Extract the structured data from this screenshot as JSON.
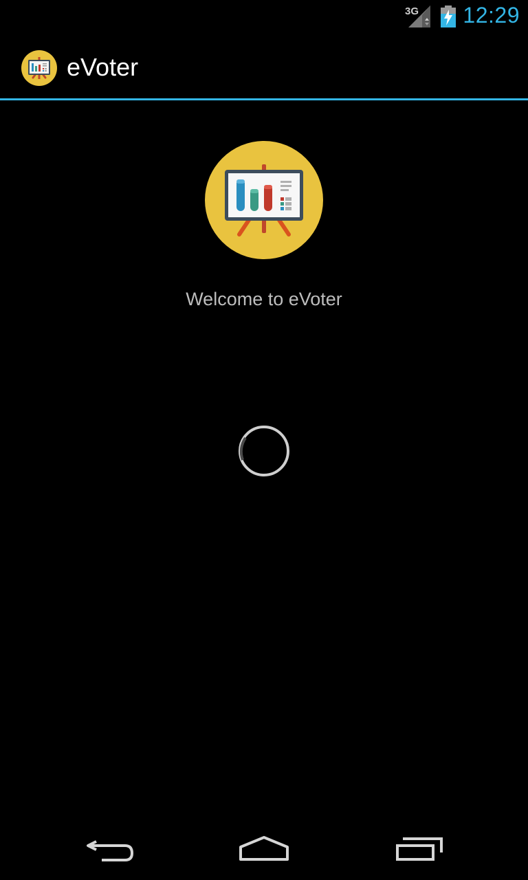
{
  "status_bar": {
    "network_type": "3G",
    "network_icon": "signal-icon",
    "battery_icon": "battery-charging-icon",
    "time": "12:29",
    "time_color": "#33b5e5"
  },
  "action_bar": {
    "app_icon": "presentation-board-icon",
    "title": "eVoter",
    "divider_color": "#33b5e5"
  },
  "content": {
    "logo_icon": "presentation-board-icon",
    "logo_bg_color": "#e9c33f",
    "welcome_text": "Welcome to eVoter",
    "loading_icon": "spinner-icon"
  },
  "nav_bar": {
    "back_icon": "back-icon",
    "home_icon": "home-icon",
    "recents_icon": "recent-apps-icon"
  }
}
